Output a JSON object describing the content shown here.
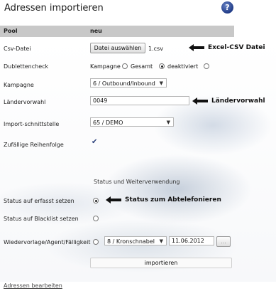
{
  "page": {
    "title": "Adressen importieren"
  },
  "header": {
    "col1": "Pool",
    "col2": "neu"
  },
  "form": {
    "csv": {
      "label": "Csv-Datei",
      "button": "Datei auswählen",
      "filename": "1.csv"
    },
    "dublettencheck": {
      "label": "Dublettencheck",
      "opt1": "Kampagne",
      "opt2": "Gesamt",
      "opt3": "deaktiviert",
      "selected": "deaktiviert"
    },
    "kampagne": {
      "label": "Kampagne",
      "value": "6 / Outbound/Inbound"
    },
    "laendervorwahl": {
      "label": "Ländervorwahl",
      "value": "0049"
    },
    "import": {
      "label": "Import-schnittstelle",
      "value": "65 / DEMO"
    },
    "zufall": {
      "label": "Zufällige Reihenfolge",
      "checked": true
    },
    "section_title": "Status und Weiterverwendung",
    "status_erfasst": {
      "label": "Status auf erfasst setzen",
      "selected": true
    },
    "status_blacklist": {
      "label": "Status auf Blacklist setzen",
      "selected": false
    },
    "wiedervorlage": {
      "label": "Wiedervorlage/Agent/Fälligkeit",
      "agent": "8 / Kronschnabel",
      "date": "11.06.2012",
      "more_button": "..."
    },
    "submit": "importieren"
  },
  "annotations": {
    "csv": "Excel-CSV Datei",
    "laender": "Ländervorwahl",
    "status": "Status zum Abtelefonieren"
  },
  "footer": {
    "link": "Adressen bearbeiten"
  }
}
